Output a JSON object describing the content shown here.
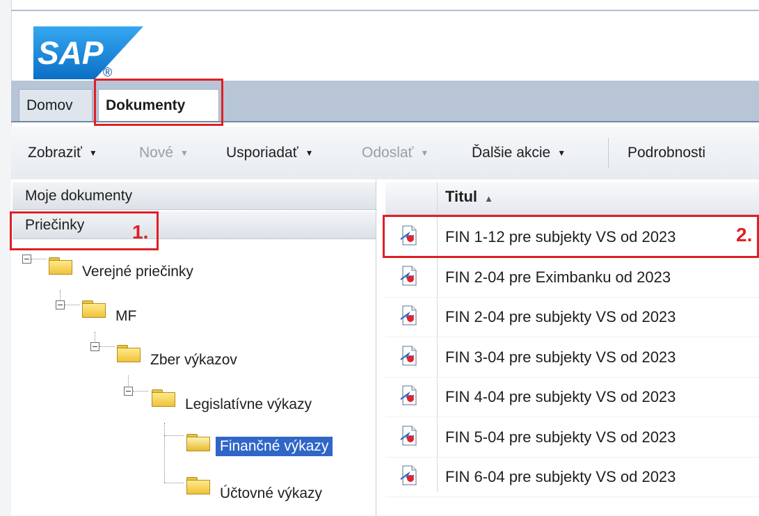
{
  "brand": {
    "logo_text": "SAP",
    "registered_mark": "®"
  },
  "tabs": [
    {
      "label": "Domov",
      "active": false
    },
    {
      "label": "Dokumenty",
      "active": true
    }
  ],
  "toolbar": {
    "items": [
      {
        "label": "Zobraziť",
        "enabled": true,
        "dropdown": true
      },
      {
        "label": "Nové",
        "enabled": false,
        "dropdown": true
      },
      {
        "label": "Usporiadať",
        "enabled": true,
        "dropdown": true
      },
      {
        "label": "Odoslať",
        "enabled": false,
        "dropdown": true
      },
      {
        "label": "Ďalšie akcie",
        "enabled": true,
        "dropdown": true
      },
      {
        "label": "Podrobnosti",
        "enabled": true,
        "dropdown": false
      }
    ],
    "dropdown_glyph": "▼"
  },
  "left_pane": {
    "sections": [
      "Moje dokumenty",
      "Priečinky"
    ],
    "tree": [
      {
        "label": "Verejné priečinky",
        "level": 0,
        "expanded": true
      },
      {
        "label": "MF",
        "level": 1,
        "expanded": true
      },
      {
        "label": "Zber výkazov",
        "level": 2,
        "expanded": true
      },
      {
        "label": "Legislatívne výkazy",
        "level": 3,
        "expanded": true
      },
      {
        "label": "Finančné výkazy",
        "level": 4,
        "selected": true
      },
      {
        "label": "Účtovné výkazy",
        "level": 4,
        "selected": false
      }
    ]
  },
  "document_list": {
    "column_title": "Titul",
    "sort_indicator": "▲",
    "rows": [
      "FIN 1-12 pre subjekty VS od 2023",
      "FIN 2-04 pre Eximbanku od 2023",
      "FIN 2-04 pre subjekty VS od 2023",
      "FIN 3-04 pre subjekty VS od 2023",
      "FIN 4-04 pre subjekty VS od 2023",
      "FIN 5-04 pre subjekty VS od 2023",
      "FIN 6-04 pre subjekty VS od 2023"
    ],
    "row_icon": "crystal-report-icon"
  },
  "annotations": {
    "marker_1": "1.",
    "marker_2": "2.",
    "highlight_color": "#e01f26"
  }
}
